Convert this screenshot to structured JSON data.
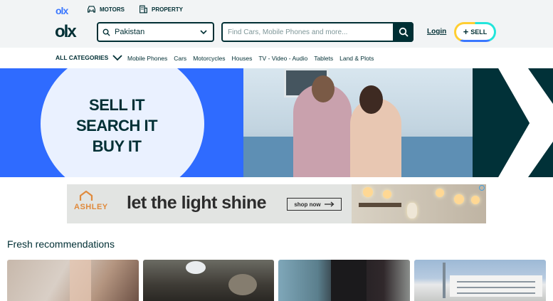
{
  "header": {
    "mini_logo": "olx",
    "verticals": [
      {
        "label": "MOTORS",
        "icon": "car-icon"
      },
      {
        "label": "PROPERTY",
        "icon": "building-icon"
      }
    ],
    "logo": "olx",
    "location": {
      "value": "Pakistan",
      "icon": "search-icon"
    },
    "search": {
      "placeholder": "Find Cars, Mobile Phones and more...",
      "value": ""
    },
    "login_label": "Login",
    "sell_label": "SELL"
  },
  "categories": {
    "all_label": "ALL CATEGORIES",
    "links": [
      "Mobile Phones",
      "Cars",
      "Motorcycles",
      "Houses",
      "TV - Video - Audio",
      "Tablets",
      "Land & Plots"
    ]
  },
  "hero": {
    "tagline": [
      "SELL IT",
      "SEARCH IT",
      "BUY IT"
    ]
  },
  "ad": {
    "brand": "ASHLEY",
    "slogan": "let the light shine",
    "cta": "shop now"
  },
  "fresh": {
    "title": "Fresh recommendations"
  },
  "colors": {
    "primary": "#002f34",
    "accent_blue": "#3a77ff",
    "accent_teal": "#23e5db",
    "accent_yellow": "#ffce32"
  }
}
